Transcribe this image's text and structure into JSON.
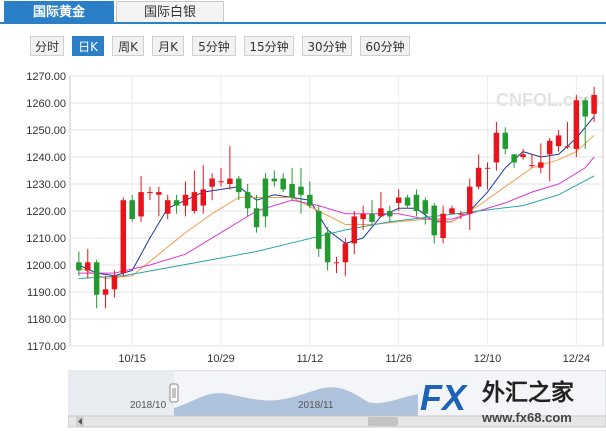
{
  "tabs": [
    {
      "label": "国际黄金",
      "active": true
    },
    {
      "label": "国际白银",
      "active": false
    }
  ],
  "periods": [
    {
      "label": "分时",
      "active": false
    },
    {
      "label": "日K",
      "active": true
    },
    {
      "label": "周K",
      "active": false
    },
    {
      "label": "月K",
      "active": false
    },
    {
      "label": "5分钟",
      "active": false
    },
    {
      "label": "15分钟",
      "active": false
    },
    {
      "label": "30分钟",
      "active": false
    },
    {
      "label": "60分钟",
      "active": false
    }
  ],
  "watermark": "CNFOL.com 中金在线",
  "logo": {
    "fx": "FX",
    "cn": "外汇之家",
    "url": "www.fx68.com"
  },
  "navigator": {
    "labels": [
      "2018/10",
      "2018/11"
    ]
  },
  "colors": {
    "accent": "#2b7fc6",
    "up": "#e8141b",
    "down": "#229a2f",
    "ma5": "#1a3a9e",
    "ma10": "#f0a050",
    "ma20": "#e038d6",
    "ma60": "#2aa6a0"
  },
  "chart_data": {
    "type": "candlestick",
    "y_ticks": [
      "1270.00",
      "1260.00",
      "1250.00",
      "1240.00",
      "1230.00",
      "1220.00",
      "1210.00",
      "1200.00",
      "1190.00",
      "1180.00",
      "1170.00"
    ],
    "ylim": [
      1170,
      1270
    ],
    "x_ticks": [
      {
        "label": "10/15",
        "index": 6
      },
      {
        "label": "10/29",
        "index": 16
      },
      {
        "label": "11/12",
        "index": 26
      },
      {
        "label": "11/26",
        "index": 36
      },
      {
        "label": "12/10",
        "index": 46
      },
      {
        "label": "12/24",
        "index": 56
      }
    ],
    "candles": [
      [
        1201,
        1198,
        1205,
        1196
      ],
      [
        1198,
        1201,
        1206,
        1195
      ],
      [
        1201,
        1189,
        1202,
        1184
      ],
      [
        1189,
        1191,
        1196,
        1184
      ],
      [
        1191,
        1196,
        1198,
        1188
      ],
      [
        1197,
        1224,
        1225,
        1196
      ],
      [
        1224,
        1217,
        1226,
        1216
      ],
      [
        1218,
        1227,
        1233,
        1216
      ],
      [
        1227,
        1227,
        1229,
        1224
      ],
      [
        1226,
        1227,
        1229,
        1218
      ],
      [
        1219,
        1224,
        1226,
        1217
      ],
      [
        1224,
        1222,
        1226,
        1219
      ],
      [
        1222,
        1226,
        1231,
        1218
      ],
      [
        1220,
        1227,
        1235,
        1219
      ],
      [
        1222,
        1228,
        1237,
        1219
      ],
      [
        1229,
        1232,
        1234,
        1224
      ],
      [
        1231,
        1231,
        1236,
        1229
      ],
      [
        1230,
        1232,
        1244,
        1228
      ],
      [
        1232,
        1227,
        1233,
        1224
      ],
      [
        1227,
        1221,
        1230,
        1218
      ],
      [
        1221,
        1214,
        1226,
        1212
      ],
      [
        1232,
        1218,
        1234,
        1214
      ],
      [
        1232,
        1231,
        1235,
        1229
      ],
      [
        1232,
        1228,
        1234,
        1227
      ],
      [
        1230,
        1225,
        1236,
        1224
      ],
      [
        1229,
        1226,
        1236,
        1219
      ],
      [
        1226,
        1222,
        1231,
        1221
      ],
      [
        1220,
        1206,
        1222,
        1203
      ],
      [
        1212,
        1201,
        1214,
        1198
      ],
      [
        1201,
        1201,
        1203,
        1197
      ],
      [
        1201,
        1208,
        1210,
        1196
      ],
      [
        1208,
        1218,
        1220,
        1204
      ],
      [
        1217,
        1219,
        1222,
        1213
      ],
      [
        1219,
        1216,
        1224,
        1215
      ],
      [
        1218,
        1221,
        1227,
        1218
      ],
      [
        1220,
        1218,
        1222,
        1216
      ],
      [
        1223,
        1225,
        1228,
        1220
      ],
      [
        1225,
        1222,
        1226,
        1221
      ],
      [
        1226,
        1220,
        1228,
        1218
      ],
      [
        1224,
        1219,
        1225,
        1215
      ],
      [
        1222,
        1211,
        1223,
        1208
      ],
      [
        1210,
        1219,
        1222,
        1208
      ],
      [
        1219,
        1221,
        1222,
        1219
      ],
      [
        1219,
        1219,
        1220,
        1217
      ],
      [
        1219,
        1229,
        1232,
        1213
      ],
      [
        1229,
        1236,
        1241,
        1228
      ],
      [
        1236,
        1236,
        1238,
        1228
      ],
      [
        1238,
        1249,
        1253,
        1235
      ],
      [
        1249,
        1243,
        1251,
        1241
      ],
      [
        1241,
        1238,
        1240,
        1236
      ],
      [
        1240,
        1241,
        1243,
        1239
      ],
      [
        1237,
        1237,
        1241,
        1236
      ],
      [
        1236,
        1238,
        1245,
        1234
      ],
      [
        1241,
        1246,
        1247,
        1231
      ],
      [
        1244,
        1248,
        1250,
        1242
      ],
      [
        1244,
        1244,
        1253,
        1243
      ],
      [
        1243,
        1261,
        1263,
        1240
      ],
      [
        1261,
        1255,
        1262,
        1243
      ],
      [
        1256,
        1263,
        1266,
        1253
      ]
    ],
    "ma": [
      {
        "key": "ma5",
        "values": [
          [
            0,
            1200
          ],
          [
            2,
            1197
          ],
          [
            4,
            1196
          ],
          [
            6,
            1198
          ],
          [
            8,
            1210
          ],
          [
            10,
            1221
          ],
          [
            12,
            1224
          ],
          [
            14,
            1227
          ],
          [
            16,
            1228
          ],
          [
            18,
            1229
          ],
          [
            20,
            1224
          ],
          [
            22,
            1226
          ],
          [
            24,
            1225
          ],
          [
            26,
            1224
          ],
          [
            28,
            1213
          ],
          [
            30,
            1208
          ],
          [
            32,
            1210
          ],
          [
            34,
            1218
          ],
          [
            36,
            1221
          ],
          [
            38,
            1221
          ],
          [
            40,
            1216
          ],
          [
            42,
            1216
          ],
          [
            44,
            1220
          ],
          [
            46,
            1227
          ],
          [
            48,
            1236
          ],
          [
            50,
            1242
          ],
          [
            52,
            1240
          ],
          [
            54,
            1241
          ],
          [
            56,
            1247
          ],
          [
            58,
            1255
          ]
        ]
      },
      {
        "key": "ma10",
        "values": [
          [
            0,
            1199
          ],
          [
            3,
            1195
          ],
          [
            6,
            1196
          ],
          [
            9,
            1204
          ],
          [
            12,
            1212
          ],
          [
            15,
            1219
          ],
          [
            18,
            1225
          ],
          [
            21,
            1225
          ],
          [
            24,
            1225
          ],
          [
            27,
            1220
          ],
          [
            30,
            1215
          ],
          [
            33,
            1215
          ],
          [
            36,
            1216
          ],
          [
            39,
            1217
          ],
          [
            42,
            1216
          ],
          [
            45,
            1222
          ],
          [
            48,
            1229
          ],
          [
            51,
            1236
          ],
          [
            54,
            1239
          ],
          [
            56,
            1242
          ],
          [
            58,
            1248
          ]
        ]
      },
      {
        "key": "ma20",
        "values": [
          [
            0,
            1197
          ],
          [
            4,
            1197
          ],
          [
            8,
            1200
          ],
          [
            12,
            1204
          ],
          [
            16,
            1212
          ],
          [
            20,
            1220
          ],
          [
            24,
            1224
          ],
          [
            27,
            1222
          ],
          [
            30,
            1219
          ],
          [
            33,
            1219
          ],
          [
            36,
            1219
          ],
          [
            39,
            1217
          ],
          [
            42,
            1217
          ],
          [
            45,
            1220
          ],
          [
            48,
            1223
          ],
          [
            51,
            1227
          ],
          [
            54,
            1230
          ],
          [
            57,
            1236
          ],
          [
            58,
            1240
          ]
        ]
      },
      {
        "key": "ma60",
        "values": [
          [
            0,
            1195
          ],
          [
            5,
            1196
          ],
          [
            10,
            1199
          ],
          [
            15,
            1202
          ],
          [
            20,
            1205
          ],
          [
            25,
            1209
          ],
          [
            30,
            1213
          ],
          [
            35,
            1216
          ],
          [
            40,
            1218
          ],
          [
            45,
            1220
          ],
          [
            50,
            1222
          ],
          [
            54,
            1226
          ],
          [
            58,
            1233
          ]
        ]
      }
    ]
  }
}
